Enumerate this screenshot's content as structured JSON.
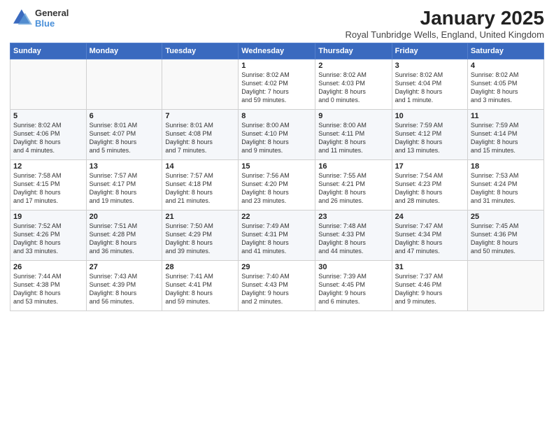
{
  "header": {
    "logo_line1": "General",
    "logo_line2": "Blue",
    "main_title": "January 2025",
    "subtitle": "Royal Tunbridge Wells, England, United Kingdom"
  },
  "days_of_week": [
    "Sunday",
    "Monday",
    "Tuesday",
    "Wednesday",
    "Thursday",
    "Friday",
    "Saturday"
  ],
  "weeks": [
    [
      {
        "day": "",
        "text": ""
      },
      {
        "day": "",
        "text": ""
      },
      {
        "day": "",
        "text": ""
      },
      {
        "day": "1",
        "text": "Sunrise: 8:02 AM\nSunset: 4:02 PM\nDaylight: 7 hours\nand 59 minutes."
      },
      {
        "day": "2",
        "text": "Sunrise: 8:02 AM\nSunset: 4:03 PM\nDaylight: 8 hours\nand 0 minutes."
      },
      {
        "day": "3",
        "text": "Sunrise: 8:02 AM\nSunset: 4:04 PM\nDaylight: 8 hours\nand 1 minute."
      },
      {
        "day": "4",
        "text": "Sunrise: 8:02 AM\nSunset: 4:05 PM\nDaylight: 8 hours\nand 3 minutes."
      }
    ],
    [
      {
        "day": "5",
        "text": "Sunrise: 8:02 AM\nSunset: 4:06 PM\nDaylight: 8 hours\nand 4 minutes."
      },
      {
        "day": "6",
        "text": "Sunrise: 8:01 AM\nSunset: 4:07 PM\nDaylight: 8 hours\nand 5 minutes."
      },
      {
        "day": "7",
        "text": "Sunrise: 8:01 AM\nSunset: 4:08 PM\nDaylight: 8 hours\nand 7 minutes."
      },
      {
        "day": "8",
        "text": "Sunrise: 8:00 AM\nSunset: 4:10 PM\nDaylight: 8 hours\nand 9 minutes."
      },
      {
        "day": "9",
        "text": "Sunrise: 8:00 AM\nSunset: 4:11 PM\nDaylight: 8 hours\nand 11 minutes."
      },
      {
        "day": "10",
        "text": "Sunrise: 7:59 AM\nSunset: 4:12 PM\nDaylight: 8 hours\nand 13 minutes."
      },
      {
        "day": "11",
        "text": "Sunrise: 7:59 AM\nSunset: 4:14 PM\nDaylight: 8 hours\nand 15 minutes."
      }
    ],
    [
      {
        "day": "12",
        "text": "Sunrise: 7:58 AM\nSunset: 4:15 PM\nDaylight: 8 hours\nand 17 minutes."
      },
      {
        "day": "13",
        "text": "Sunrise: 7:57 AM\nSunset: 4:17 PM\nDaylight: 8 hours\nand 19 minutes."
      },
      {
        "day": "14",
        "text": "Sunrise: 7:57 AM\nSunset: 4:18 PM\nDaylight: 8 hours\nand 21 minutes."
      },
      {
        "day": "15",
        "text": "Sunrise: 7:56 AM\nSunset: 4:20 PM\nDaylight: 8 hours\nand 23 minutes."
      },
      {
        "day": "16",
        "text": "Sunrise: 7:55 AM\nSunset: 4:21 PM\nDaylight: 8 hours\nand 26 minutes."
      },
      {
        "day": "17",
        "text": "Sunrise: 7:54 AM\nSunset: 4:23 PM\nDaylight: 8 hours\nand 28 minutes."
      },
      {
        "day": "18",
        "text": "Sunrise: 7:53 AM\nSunset: 4:24 PM\nDaylight: 8 hours\nand 31 minutes."
      }
    ],
    [
      {
        "day": "19",
        "text": "Sunrise: 7:52 AM\nSunset: 4:26 PM\nDaylight: 8 hours\nand 33 minutes."
      },
      {
        "day": "20",
        "text": "Sunrise: 7:51 AM\nSunset: 4:28 PM\nDaylight: 8 hours\nand 36 minutes."
      },
      {
        "day": "21",
        "text": "Sunrise: 7:50 AM\nSunset: 4:29 PM\nDaylight: 8 hours\nand 39 minutes."
      },
      {
        "day": "22",
        "text": "Sunrise: 7:49 AM\nSunset: 4:31 PM\nDaylight: 8 hours\nand 41 minutes."
      },
      {
        "day": "23",
        "text": "Sunrise: 7:48 AM\nSunset: 4:33 PM\nDaylight: 8 hours\nand 44 minutes."
      },
      {
        "day": "24",
        "text": "Sunrise: 7:47 AM\nSunset: 4:34 PM\nDaylight: 8 hours\nand 47 minutes."
      },
      {
        "day": "25",
        "text": "Sunrise: 7:45 AM\nSunset: 4:36 PM\nDaylight: 8 hours\nand 50 minutes."
      }
    ],
    [
      {
        "day": "26",
        "text": "Sunrise: 7:44 AM\nSunset: 4:38 PM\nDaylight: 8 hours\nand 53 minutes."
      },
      {
        "day": "27",
        "text": "Sunrise: 7:43 AM\nSunset: 4:39 PM\nDaylight: 8 hours\nand 56 minutes."
      },
      {
        "day": "28",
        "text": "Sunrise: 7:41 AM\nSunset: 4:41 PM\nDaylight: 8 hours\nand 59 minutes."
      },
      {
        "day": "29",
        "text": "Sunrise: 7:40 AM\nSunset: 4:43 PM\nDaylight: 9 hours\nand 2 minutes."
      },
      {
        "day": "30",
        "text": "Sunrise: 7:39 AM\nSunset: 4:45 PM\nDaylight: 9 hours\nand 6 minutes."
      },
      {
        "day": "31",
        "text": "Sunrise: 7:37 AM\nSunset: 4:46 PM\nDaylight: 9 hours\nand 9 minutes."
      },
      {
        "day": "",
        "text": ""
      }
    ]
  ]
}
